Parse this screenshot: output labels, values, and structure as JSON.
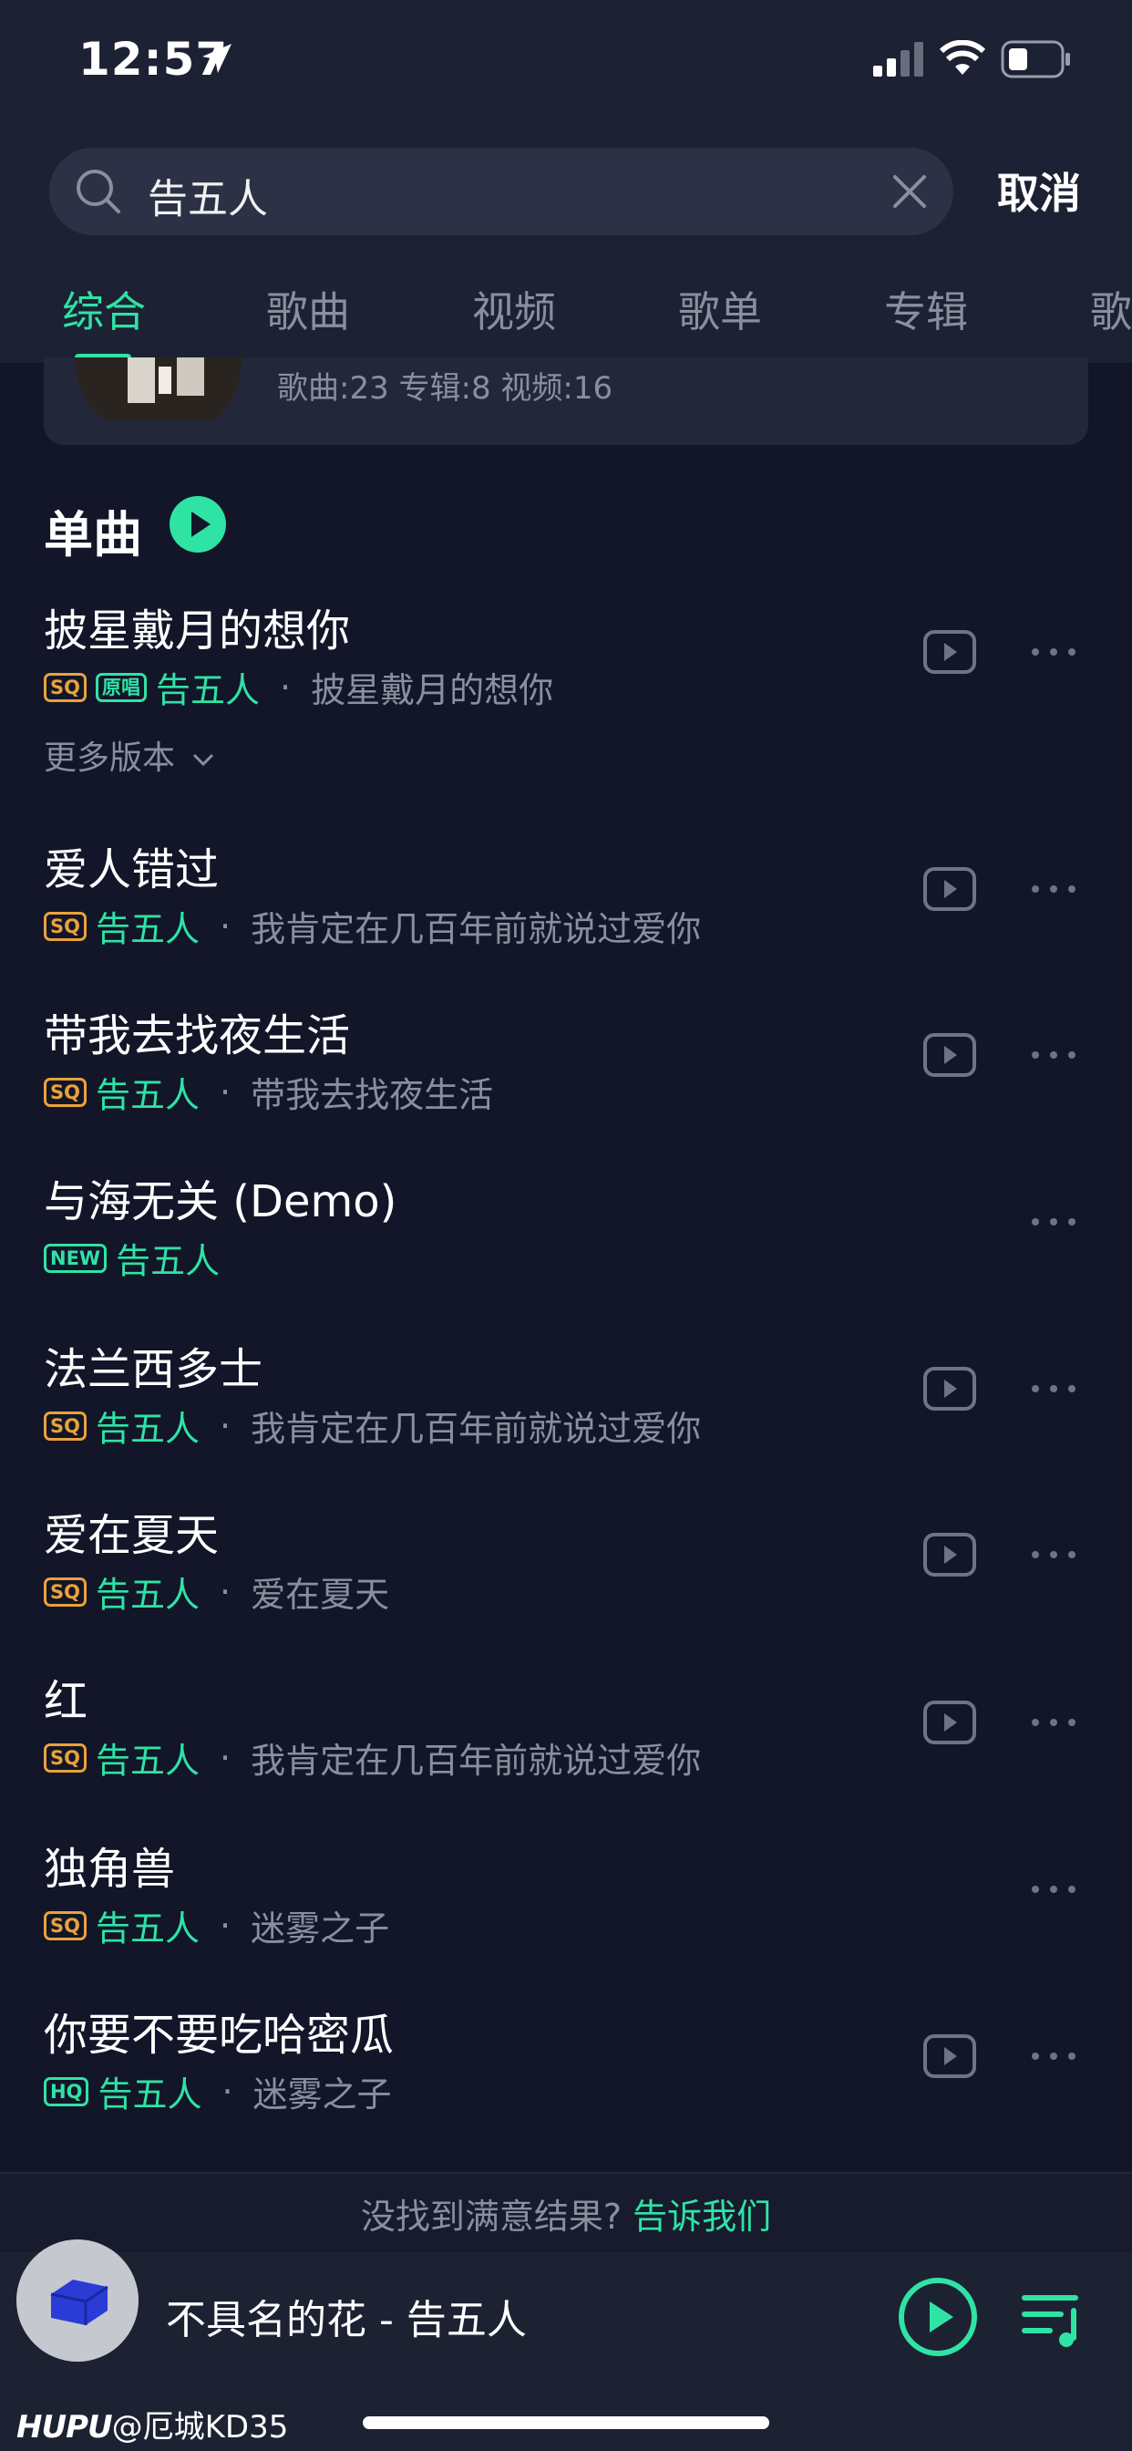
{
  "status_bar": {
    "time": "12:57"
  },
  "search": {
    "query": "告五人",
    "cancel_label": "取消"
  },
  "tabs": [
    {
      "label": "综合",
      "active": true
    },
    {
      "label": "歌曲",
      "active": false
    },
    {
      "label": "视频",
      "active": false
    },
    {
      "label": "歌单",
      "active": false
    },
    {
      "label": "专辑",
      "active": false
    },
    {
      "label": "歌",
      "active": false
    }
  ],
  "artist_card": {
    "stats": "歌曲:23 专辑:8 视频:16"
  },
  "section": {
    "title": "单曲"
  },
  "songs": [
    {
      "title": "披星戴月的想你",
      "badges": [
        "SQ",
        "原唱"
      ],
      "artist": "告五人",
      "album": "披星戴月的想你",
      "has_mv": true
    },
    {
      "title": "爱人错过",
      "badges": [
        "SQ"
      ],
      "artist": "告五人",
      "album": "我肯定在几百年前就说过爱你",
      "has_mv": true
    },
    {
      "title": "带我去找夜生活",
      "badges": [
        "SQ"
      ],
      "artist": "告五人",
      "album": "带我去找夜生活",
      "has_mv": true
    },
    {
      "title": "与海无关 (Demo)",
      "badges": [
        "NEW"
      ],
      "artist": "告五人",
      "album": "",
      "has_mv": false
    },
    {
      "title": "法兰西多士",
      "badges": [
        "SQ"
      ],
      "artist": "告五人",
      "album": "我肯定在几百年前就说过爱你",
      "has_mv": true
    },
    {
      "title": "爱在夏天",
      "badges": [
        "SQ"
      ],
      "artist": "告五人",
      "album": "爱在夏天",
      "has_mv": true
    },
    {
      "title": "红",
      "badges": [
        "SQ"
      ],
      "artist": "告五人",
      "album": "我肯定在几百年前就说过爱你",
      "has_mv": true
    },
    {
      "title": "独角兽",
      "badges": [
        "SQ"
      ],
      "artist": "告五人",
      "album": "迷雾之子",
      "has_mv": false
    },
    {
      "title": "你要不要吃哈密瓜",
      "badges": [
        "HQ"
      ],
      "artist": "告五人",
      "album": "迷雾之子",
      "has_mv": true
    }
  ],
  "more_versions_label": "更多版本",
  "feedback": {
    "text": "没找到满意结果?",
    "link": "告诉我们"
  },
  "player": {
    "now_playing": "不具名的花 - 告五人"
  },
  "watermark": {
    "brand": "HUPU",
    "user": "@厄城KD35"
  },
  "colors": {
    "accent": "#2fe3a5",
    "sq": "#e9a23b",
    "background": "#121628",
    "muted": "#8a8f9e"
  }
}
